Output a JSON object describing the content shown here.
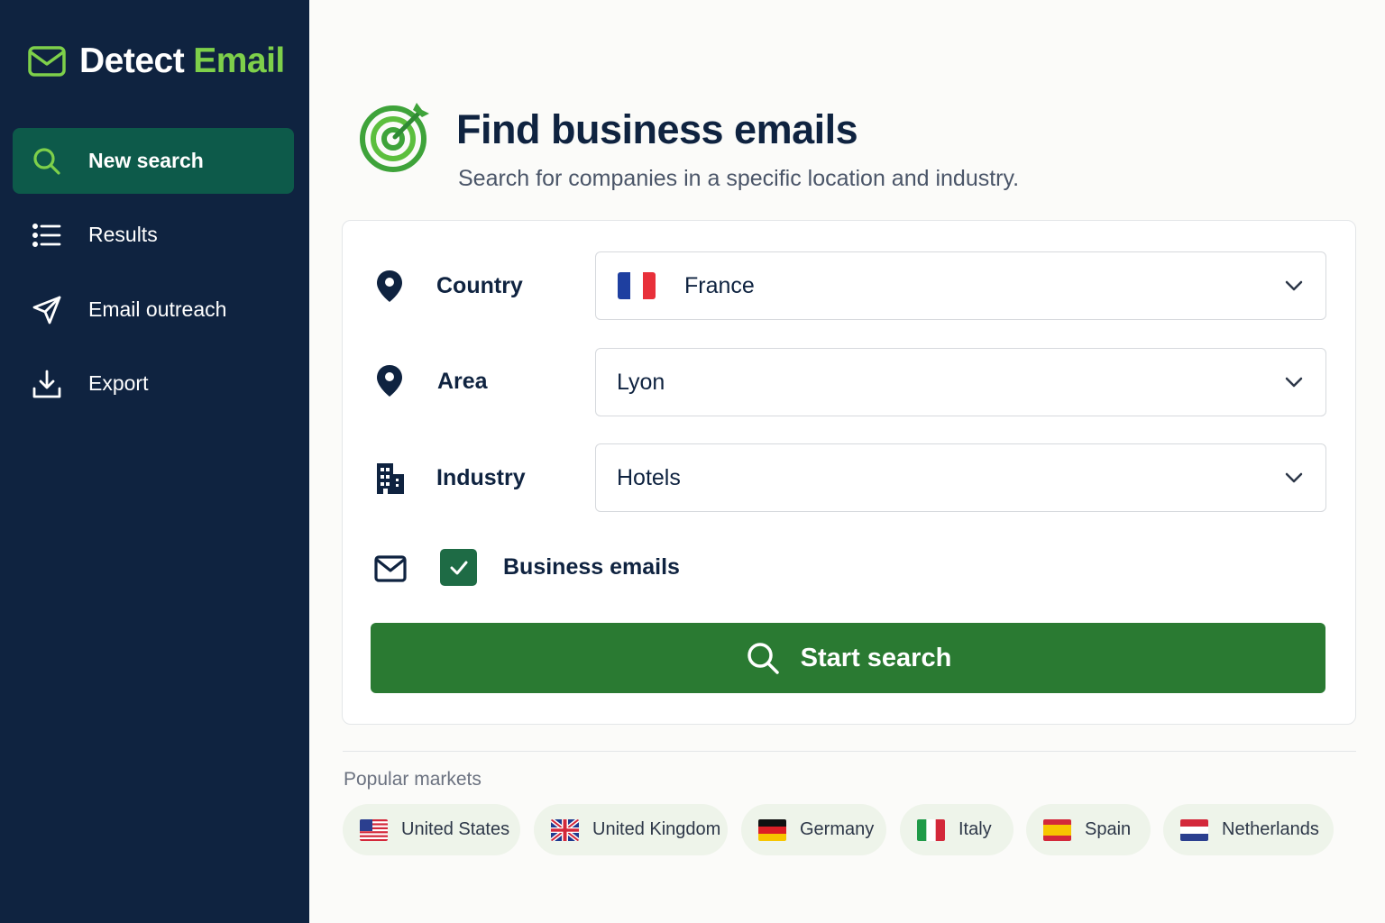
{
  "app": {
    "brand_part1": "Detect",
    "brand_part2": "Email",
    "brand_icon": "envelope-icon",
    "accent_color": "#7ed04a",
    "sidebar_color": "#0f2340"
  },
  "sidebar": {
    "items": [
      {
        "label": "New search",
        "icon": "search-icon",
        "active": true
      },
      {
        "label": "Results",
        "icon": "list-icon",
        "active": false
      },
      {
        "label": "Email outreach",
        "icon": "send-icon",
        "active": false
      },
      {
        "label": "Export",
        "icon": "download-icon",
        "active": false
      }
    ]
  },
  "header": {
    "title": "Find business emails",
    "subtitle": "Search for companies in a specific location and industry.",
    "icon": "target-icon"
  },
  "form": {
    "country": {
      "label": "Country",
      "value": "France",
      "icon": "location-pin-icon"
    },
    "area": {
      "label": "Area",
      "value": "Lyon",
      "icon": "location-pin-icon"
    },
    "industry": {
      "label": "Industry",
      "value": "Hotels",
      "icon": "building-icon"
    },
    "business_emails": {
      "label": "Business emails",
      "checked": true,
      "icon": "envelope-icon"
    },
    "submit_label": "Start search",
    "button_color": "#2a7a32"
  },
  "popular": {
    "label": "Popular markets",
    "markets": [
      {
        "label": "United States",
        "flag": "us-flag"
      },
      {
        "label": "United Kingdom",
        "flag": "uk-flag"
      },
      {
        "label": "Germany",
        "flag": "de-flag"
      },
      {
        "label": "Italy",
        "flag": "it-flag"
      },
      {
        "label": "Spain",
        "flag": "es-flag"
      },
      {
        "label": "Netherlands",
        "flag": "nl-flag"
      }
    ]
  }
}
